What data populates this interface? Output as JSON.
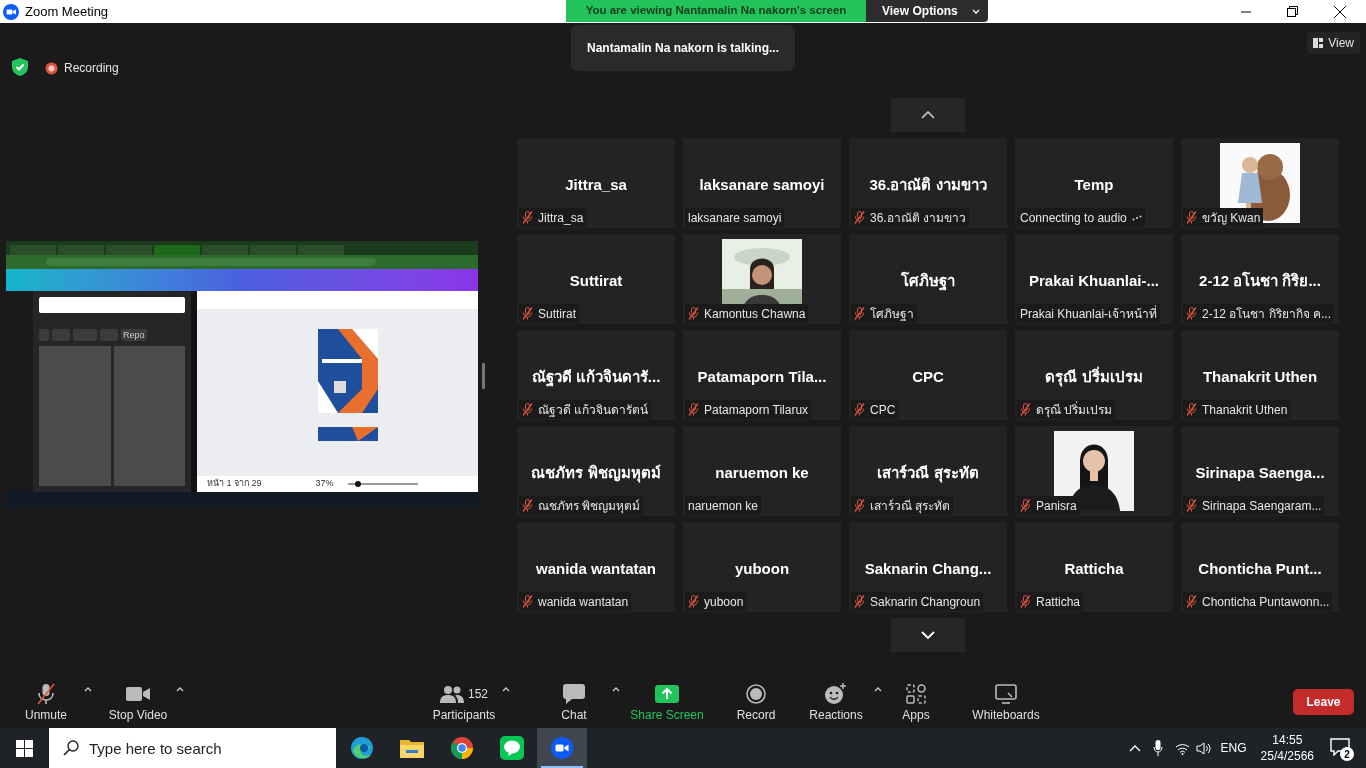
{
  "window": {
    "title": "Zoom Meeting"
  },
  "share_banner": {
    "text": "You are viewing Nantamalin Na nakorn's screen",
    "button": "View Options"
  },
  "talking": "Nantamalin Na nakorn is talking...",
  "recording": "Recording",
  "view_button": "View",
  "shared_screen": {
    "search_chip": "Repo",
    "page_count": "หน้า 1 จาก 29",
    "zoom_level": "37%",
    "zoom_slider": {
      "level": 0.12
    }
  },
  "tiles": [
    {
      "kind": "name",
      "name": "Jittra_sa",
      "label": "Jittra_sa",
      "muted": true
    },
    {
      "kind": "name",
      "name": "laksanare samoyi",
      "label": "laksanare samoyi",
      "muted": false
    },
    {
      "kind": "name",
      "name": "36.อาณัติ งามขาว",
      "label": "36.อาณัติ งามขาว",
      "muted": true
    },
    {
      "kind": "name",
      "name": "Temp",
      "label": "Connecting to audio",
      "muted": false,
      "connecting": true
    },
    {
      "kind": "picture",
      "label": "ขวัญ Kwan",
      "muted": true
    },
    {
      "kind": "name",
      "name": "Suttirat",
      "label": "Suttirat",
      "muted": true
    },
    {
      "kind": "picture",
      "label": "Kamontus Chawna",
      "muted": true
    },
    {
      "kind": "name",
      "name": "โศภิษฐา",
      "label": "โศภิษฐา",
      "muted": true
    },
    {
      "kind": "name",
      "name": "Prakai  Khuanlai-...",
      "label": "Prakai Khuanlai-เจ้าหน้าที่",
      "muted": false
    },
    {
      "kind": "name",
      "name": "2-12 อโนชา กิริย...",
      "label": "2-12 อโนชา กิริยากิจ ค...",
      "muted": true
    },
    {
      "kind": "name",
      "name": "ณัฐวดี แก้วจินดารั...",
      "label": "ณัฐวดี แก้วจินดารัตน์",
      "muted": true
    },
    {
      "kind": "name",
      "name": "Patamaporn  Tila...",
      "label": "Patamaporn Tilarux",
      "muted": true
    },
    {
      "kind": "name",
      "name": "CPC",
      "label": "CPC",
      "muted": true
    },
    {
      "kind": "name",
      "name": "ดรุณี ปริ่มเปรม",
      "label": "ดรุณี ปริ่มเปรม",
      "muted": true
    },
    {
      "kind": "name",
      "name": "Thanakrit Uthen",
      "label": "Thanakrit Uthen",
      "muted": true
    },
    {
      "kind": "name",
      "name": "ณชภัทร พิชญมหุตม์",
      "label": "ณชภัทร พิชญมหุตม์",
      "muted": true
    },
    {
      "kind": "name",
      "name": "naruemon ke",
      "label": "naruemon ke",
      "muted": false
    },
    {
      "kind": "name",
      "name": "เสาร์วณี  สุระทัต",
      "label": "เสาร์วณี  สุระทัต",
      "muted": true
    },
    {
      "kind": "picture",
      "label": "Panisra",
      "muted": true
    },
    {
      "kind": "name",
      "name": "Sirinapa  Saenga...",
      "label": "Sirinapa Saengaram...",
      "muted": true
    },
    {
      "kind": "name",
      "name": "wanida wantatan",
      "label": "wanida wantatan",
      "muted": true
    },
    {
      "kind": "name",
      "name": "yuboon",
      "label": "yuboon",
      "muted": true
    },
    {
      "kind": "name",
      "name": "Saknarin  Chang...",
      "label": "Saknarin Changroun",
      "muted": true
    },
    {
      "kind": "name",
      "name": "Ratticha",
      "label": "Ratticha",
      "muted": true
    },
    {
      "kind": "name",
      "name": "Chonticha  Punt...",
      "label": "Chonticha Puntawonn...",
      "muted": true
    }
  ],
  "toolbar": [
    {
      "kind": "unmute",
      "label": "Unmute",
      "caret": true
    },
    {
      "kind": "video",
      "label": "Stop Video",
      "caret": true
    },
    {
      "kind": "participants",
      "label": "Participants",
      "count": "152",
      "caret": true
    },
    {
      "kind": "chat",
      "label": "Chat",
      "caret": true
    },
    {
      "kind": "share",
      "label": "Share Screen",
      "caret": false
    },
    {
      "kind": "record",
      "label": "Record",
      "caret": false
    },
    {
      "kind": "reactions",
      "label": "Reactions",
      "caret": true
    },
    {
      "kind": "apps",
      "label": "Apps",
      "caret": false
    },
    {
      "kind": "whiteboards",
      "label": "Whiteboards",
      "caret": false
    }
  ],
  "leave": "Leave",
  "taskbar": {
    "search_placeholder": "Type here to search",
    "apps": [
      {
        "kind": "edge",
        "selected": false
      },
      {
        "kind": "explorer",
        "selected": false
      },
      {
        "kind": "chrome",
        "selected": false
      },
      {
        "kind": "line",
        "selected": false
      },
      {
        "kind": "zoom",
        "selected": true
      }
    ],
    "language": "ENG",
    "time": "14:55",
    "date": "25/4/2566",
    "notifications": "2"
  }
}
